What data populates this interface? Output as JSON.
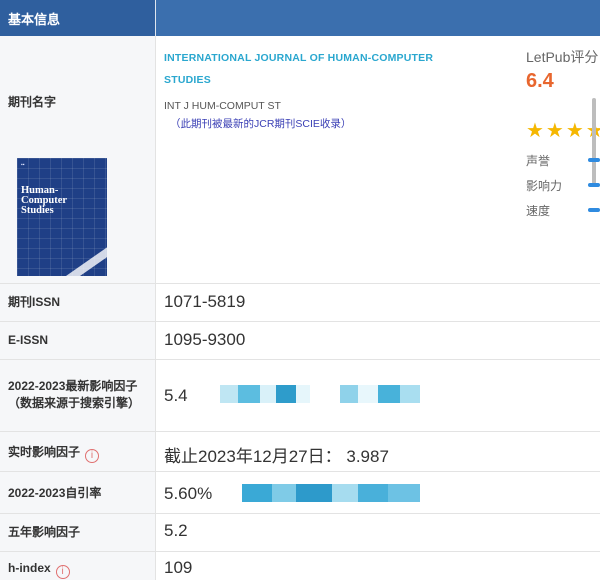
{
  "header": {
    "title": "基本信息"
  },
  "journal": {
    "label": "期刊名字",
    "full_name": "INTERNATIONAL JOURNAL OF HUMAN-COMPUTER STUDIES",
    "abbreviation": "INT J HUM-COMPUT ST",
    "index_note": "（此期刊被最新的JCR期刊SCIE收录）",
    "cover": {
      "title_line1": "Human-",
      "title_line2": "Computer",
      "title_line3": "Studies"
    }
  },
  "letpub": {
    "title": "LetPub评分",
    "score": "6.4",
    "stars": "★★★★",
    "metrics": [
      {
        "label": "声誉"
      },
      {
        "label": "影响力"
      },
      {
        "label": "速度"
      }
    ]
  },
  "rows": [
    {
      "label": "期刊ISSN",
      "value": "1071-5819"
    },
    {
      "label": "E-ISSN",
      "value": "1095-9300"
    },
    {
      "label_line1": "2022-2023最新影响因子",
      "label_line2": "（数据来源于搜索引擎）",
      "value": "5.4"
    },
    {
      "label": "实时影响因子",
      "info_icon": "info-icon",
      "value": "截止2023年12月27日： 3.987"
    },
    {
      "label": "2022-2023自引率",
      "value": "5.60%"
    },
    {
      "label": "五年影响因子",
      "value": "5.2"
    },
    {
      "label": "h-index",
      "info_icon": "info-icon",
      "value": "109"
    }
  ],
  "colors": {
    "header_bg": "#3b6fae",
    "journal_name": "#2aa7cf",
    "score": "#e8662e",
    "star": "#f5b700",
    "note": "#3a3fb5"
  }
}
